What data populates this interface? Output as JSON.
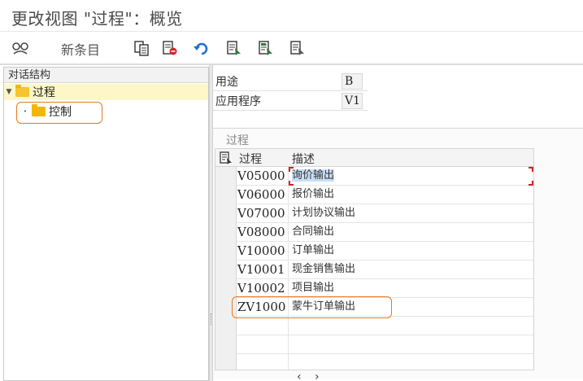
{
  "window": {
    "title": "更改视图 \"过程\"：概览"
  },
  "toolbar": {
    "new_entries_label": "新条目",
    "icons": [
      "glasses-toggle-icon",
      "copy-icon",
      "delete-icon",
      "undo-icon",
      "select-all-icon",
      "select-block-icon",
      "deselect-all-icon"
    ]
  },
  "tree": {
    "header": "对话结构",
    "items": [
      {
        "label": "过程",
        "expanded": true,
        "selected": true
      },
      {
        "label": "控制"
      }
    ]
  },
  "fields": [
    {
      "label": "用途",
      "value": "B"
    },
    {
      "label": "应用程序",
      "value": "V1"
    }
  ],
  "group": {
    "title": "过程",
    "columns": [
      "过程",
      "描述"
    ],
    "rows": [
      {
        "proc": "V05000",
        "desc": "询价输出"
      },
      {
        "proc": "V06000",
        "desc": "报价输出"
      },
      {
        "proc": "V07000",
        "desc": "计划协议输出"
      },
      {
        "proc": "V08000",
        "desc": "合同输出"
      },
      {
        "proc": "V10000",
        "desc": "订单输出"
      },
      {
        "proc": "V10001",
        "desc": "现金销售输出"
      },
      {
        "proc": "V10002",
        "desc": "项目输出"
      },
      {
        "proc": "ZV1000",
        "desc": "蒙牛订单输出"
      }
    ]
  },
  "colors": {
    "annotation": "#e8791d",
    "selection": "#c8def5",
    "tree_selected": "#fdf7c8",
    "folder": "#f2b705",
    "focus": "#d32020"
  }
}
